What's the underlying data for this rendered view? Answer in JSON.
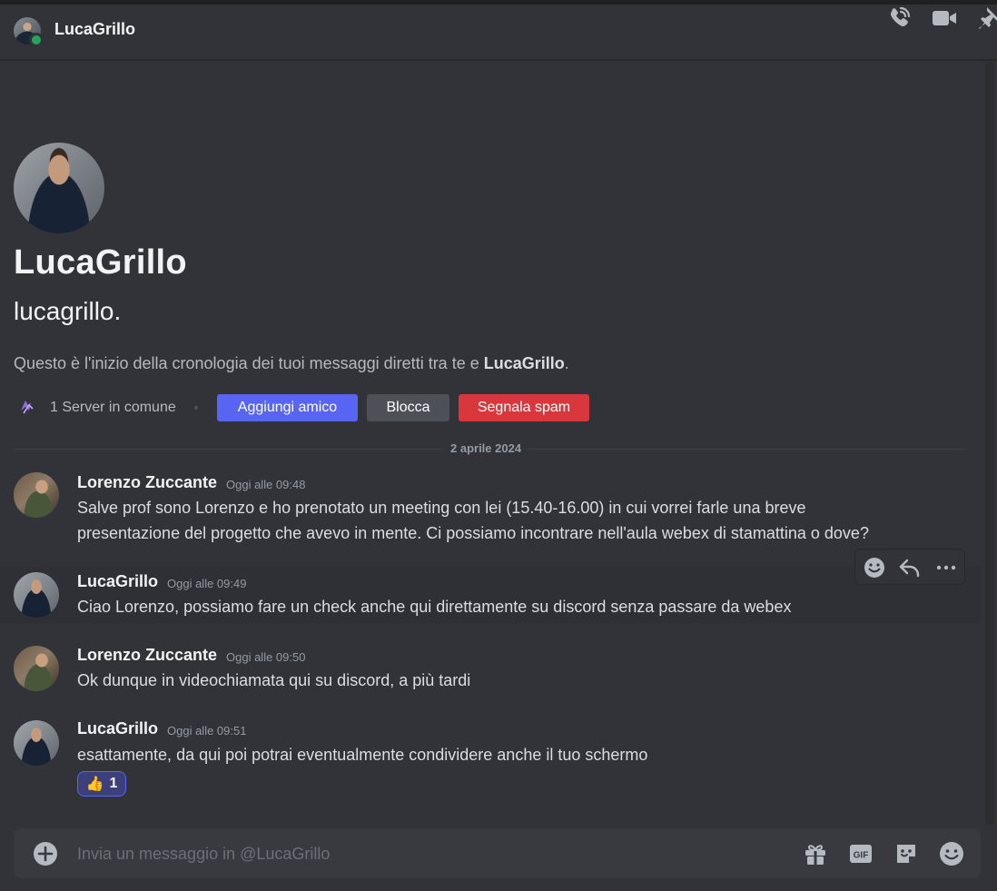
{
  "header": {
    "name": "LucaGrillo",
    "icons": [
      "phone-call-icon",
      "video-camera-icon",
      "pin-icon"
    ]
  },
  "profile": {
    "display_name": "LucaGrillo",
    "username": "lucagrillo.",
    "intro_prefix": "Questo è l'inizio della cronologia dei tuoi messaggi diretti tra te e ",
    "intro_name": "LucaGrillo",
    "intro_suffix": ".",
    "mutual_servers": "1 Server in comune",
    "buttons": {
      "add_friend": "Aggiungi amico",
      "block": "Blocca",
      "report_spam": "Segnala spam"
    }
  },
  "date_divider": "2 aprile 2024",
  "messages": [
    {
      "author": "Lorenzo Zuccante",
      "time": "Oggi alle 09:48",
      "lines": [
        "Salve prof sono Lorenzo e ho prenotato un meeting con lei (15.40-16.00) in cui vorrei farle una breve",
        "presentazione del progetto che avevo in mente. Ci possiamo incontrare nell'aula webex di stamattina o dove?"
      ]
    },
    {
      "author": "LucaGrillo",
      "time": "Oggi alle 09:49",
      "lines": [
        "Ciao Lorenzo, possiamo fare un check anche qui direttamente su discord senza passare da webex"
      ]
    },
    {
      "author": "Lorenzo Zuccante",
      "time": "Oggi alle 09:50",
      "lines": [
        "Ok dunque in videochiamata qui su discord, a più tardi"
      ]
    },
    {
      "author": "LucaGrillo",
      "time": "Oggi alle 09:51",
      "lines": [
        "esattamente, da qui poi potrai eventualmente condividere anche il tuo schermo"
      ],
      "reaction": {
        "emoji": "👍",
        "count": "1"
      }
    }
  ],
  "composer": {
    "placeholder": "Invia un messaggio in @LucaGrillo",
    "gif_label": "GIF"
  },
  "colors": {
    "background": "#313338",
    "accent": "#5865f2",
    "danger": "#da373c",
    "online": "#23a55a"
  }
}
